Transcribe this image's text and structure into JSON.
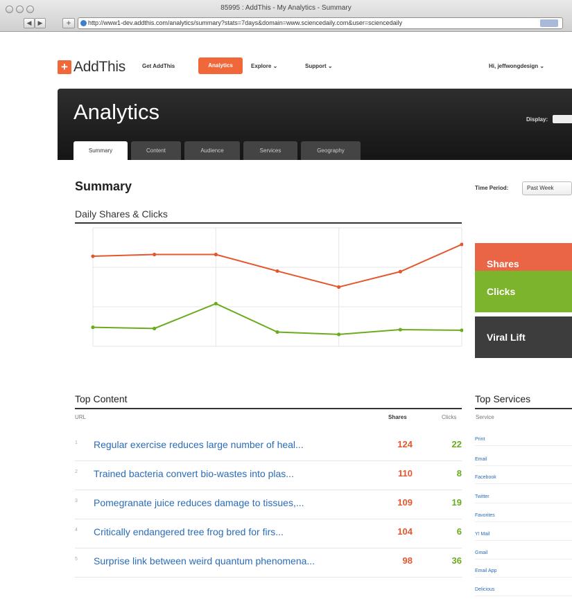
{
  "browser": {
    "window_title": "85995 : AddThis - My Analytics - Summary",
    "url": "http://www1-dev.addthis.com/analytics/summary?stats=7days&domain=www.sciencedaily.com&user=sciencedaily"
  },
  "header": {
    "logo_mark": "+",
    "logo_text": "AddThis",
    "nav": [
      {
        "label": "Get AddThis"
      },
      {
        "label": "Analytics"
      },
      {
        "label": "Explore"
      },
      {
        "label": "Support"
      }
    ],
    "user_greeting": "Hi, jeffwongdesign"
  },
  "banner": {
    "title": "Analytics",
    "display_label": "Display:",
    "tabs": [
      {
        "label": "Summary"
      },
      {
        "label": "Content"
      },
      {
        "label": "Audience"
      },
      {
        "label": "Services"
      },
      {
        "label": "Geography"
      }
    ]
  },
  "summary": {
    "heading": "Summary",
    "time_period_label": "Time Period:",
    "time_period_value": "Past Week",
    "chart_title": "Daily Shares & Clicks"
  },
  "chart_data": {
    "type": "line",
    "title": "Daily Shares & Clicks",
    "x": [
      1,
      2,
      3,
      4,
      5,
      6,
      7
    ],
    "ylim": [
      0,
      2000
    ],
    "grid": true,
    "series": [
      {
        "name": "Shares",
        "color": "#e4572e",
        "values": [
          1520,
          1550,
          1550,
          1270,
          1000,
          1260,
          1720
        ]
      },
      {
        "name": "Clicks",
        "color": "#6aac1d",
        "values": [
          320,
          300,
          720,
          240,
          200,
          280,
          270
        ]
      }
    ]
  },
  "metrics": [
    {
      "label": "Shares",
      "color": "#ea6545"
    },
    {
      "label": "Clicks",
      "color": "#7cb52c"
    },
    {
      "label": "Viral Lift",
      "color": "#3d3d3d"
    }
  ],
  "top_content": {
    "heading": "Top Content",
    "col_url": "URL",
    "col_shares": "Shares",
    "col_clicks": "Clicks",
    "rows": [
      {
        "num": "1",
        "title": "Regular exercise reduces large number of heal...",
        "shares": "124",
        "clicks": "22"
      },
      {
        "num": "2",
        "title": "Trained bacteria convert bio-wastes into plas...",
        "shares": "110",
        "clicks": "8"
      },
      {
        "num": "3",
        "title": "Pomegranate juice reduces damage to tissues,...",
        "shares": "109",
        "clicks": "19"
      },
      {
        "num": "4",
        "title": "Critically endangered tree frog bred for firs...",
        "shares": "104",
        "clicks": "6"
      },
      {
        "num": "5",
        "title": "Surprise link between weird quantum phenomena...",
        "shares": "98",
        "clicks": "36"
      }
    ]
  },
  "top_services": {
    "heading": "Top Services",
    "col_service": "Service",
    "items": [
      {
        "label": "Print"
      },
      {
        "label": "Email"
      },
      {
        "label": "Facebook"
      },
      {
        "label": "Twitter"
      },
      {
        "label": "Favorites"
      },
      {
        "label": "Y! Mail"
      },
      {
        "label": "Gmail"
      },
      {
        "label": "Email App"
      },
      {
        "label": "Delicious"
      }
    ]
  }
}
